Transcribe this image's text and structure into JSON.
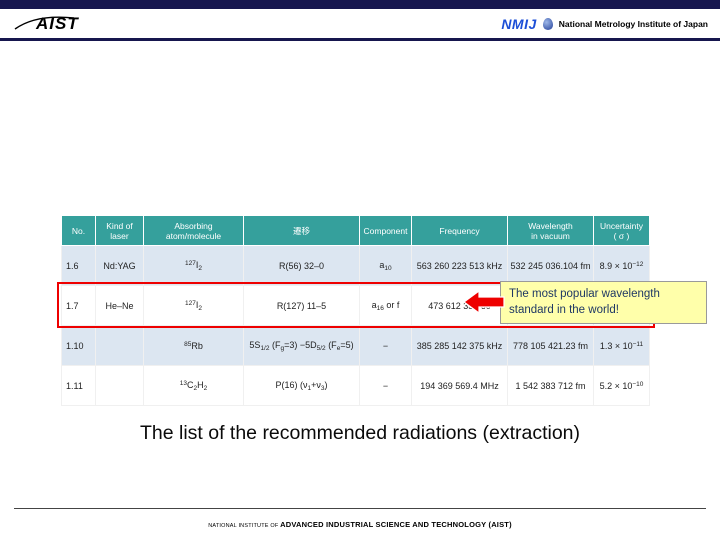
{
  "header": {
    "aist": "AIST",
    "nmij": "NMIJ",
    "nmij_full": "National Metrology Institute of Japan"
  },
  "table": {
    "col_ids": [
      "no",
      "kind-of-laser",
      "absorbing-atom-molecule",
      "transition",
      "component",
      "frequency",
      "wavelength-in-vacuum",
      "uncertainty"
    ],
    "headers": [
      "No.",
      "Kind of laser",
      "Absorbing atom/molecule",
      "遷移",
      "Component",
      "Frequency",
      "Wavelength\nin vacuum",
      "Uncertainty\n( σ )"
    ],
    "rows": [
      {
        "cells": [
          [
            {
              "t": "1.6"
            }
          ],
          [
            {
              "t": "Nd:YAG"
            }
          ],
          [
            {
              "s": "sup",
              "t": "127"
            },
            {
              "t": "I"
            },
            {
              "s": "sub",
              "t": "2"
            }
          ],
          [
            {
              "t": "R(56) 32–0"
            }
          ],
          [
            {
              "t": "a"
            },
            {
              "s": "sub",
              "t": "10"
            }
          ],
          [
            {
              "t": "563 260 223 513 kHz"
            }
          ],
          [
            {
              "t": "532 245 036.104 fm"
            }
          ],
          [
            {
              "t": "8.9 × 10"
            },
            {
              "s": "sup",
              "t": "−12"
            }
          ]
        ]
      },
      {
        "cells": [
          [
            {
              "t": "1.7"
            }
          ],
          [
            {
              "t": "He–Ne"
            }
          ],
          [
            {
              "s": "sup",
              "t": "127"
            },
            {
              "t": "I"
            },
            {
              "s": "sub",
              "t": "2"
            }
          ],
          [
            {
              "t": "R(127) 11–5"
            }
          ],
          [
            {
              "t": "a"
            },
            {
              "s": "sub",
              "t": "16"
            },
            {
              "t": " or f"
            }
          ],
          [
            {
              "t": "473 612 353 60"
            }
          ],
          [],
          []
        ]
      },
      {
        "cells": [
          [
            {
              "t": "1.10"
            }
          ],
          [
            {
              "t": ""
            }
          ],
          [
            {
              "s": "sup",
              "t": "85"
            },
            {
              "t": "Rb"
            }
          ],
          [
            {
              "t": "5S"
            },
            {
              "s": "sub",
              "t": "1/2"
            },
            {
              "t": " (F"
            },
            {
              "s": "sub",
              "t": "g"
            },
            {
              "t": "=3) −5D"
            },
            {
              "s": "sub",
              "t": "5/2"
            },
            {
              "t": " (F"
            },
            {
              "s": "sub",
              "t": "e"
            },
            {
              "t": "=5)"
            }
          ],
          [
            {
              "t": "−"
            }
          ],
          [
            {
              "t": "385 285 142 375 kHz"
            }
          ],
          [
            {
              "t": "778 105 421.23 fm"
            }
          ],
          [
            {
              "t": "1.3 × 10"
            },
            {
              "s": "sup",
              "t": "−11"
            }
          ]
        ]
      },
      {
        "cells": [
          [
            {
              "t": "1.11"
            }
          ],
          [
            {
              "t": ""
            }
          ],
          [
            {
              "s": "sup",
              "t": "13"
            },
            {
              "t": "C"
            },
            {
              "s": "sub",
              "t": "2"
            },
            {
              "t": "H"
            },
            {
              "s": "sub",
              "t": "2"
            }
          ],
          [
            {
              "t": "P(16) (ν"
            },
            {
              "s": "sub",
              "t": "1"
            },
            {
              "t": "+ν"
            },
            {
              "s": "sub",
              "t": "3"
            },
            {
              "t": ")"
            }
          ],
          [
            {
              "t": "−"
            }
          ],
          [
            {
              "t": "194 369 569.4 MHz"
            }
          ],
          [
            {
              "t": "1 542 383 712 fm"
            }
          ],
          [
            {
              "t": "5.2 × 10"
            },
            {
              "s": "sup",
              "t": "−10"
            }
          ]
        ]
      }
    ]
  },
  "callout": {
    "text": "The most popular wavelength standard in the world!"
  },
  "caption": "The list of the recommended radiations (extraction)",
  "footer": {
    "small": "NATIONAL INSTITUTE OF ",
    "bold": "ADVANCED INDUSTRIAL SCIENCE AND TECHNOLOGY (AIST)"
  },
  "colors": {
    "table_header": "#35a09c",
    "row_shade": "#dce6f1",
    "highlight": "#ee0000",
    "callout_bg": "#ffffaa",
    "navy_bar": "#16164e",
    "nmij_blue": "#1d4fd7"
  }
}
